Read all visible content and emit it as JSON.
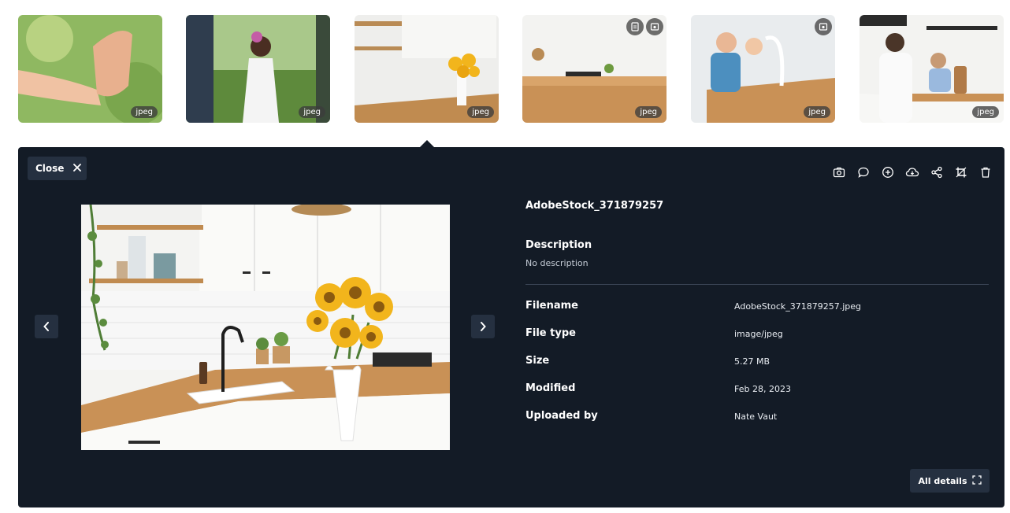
{
  "thumbnails": [
    {
      "badge": "jpeg",
      "has_overlay_icons": false
    },
    {
      "badge": "jpeg",
      "has_overlay_icons": false
    },
    {
      "badge": "jpeg",
      "has_overlay_icons": false
    },
    {
      "badge": "jpeg",
      "has_overlay_icons": true
    },
    {
      "badge": "jpeg",
      "has_overlay_icons": true
    },
    {
      "badge": "jpeg",
      "has_overlay_icons": false
    }
  ],
  "panel": {
    "close_label": "Close",
    "title": "AdobeStock_371879257",
    "description_heading": "Description",
    "description_value": "No description",
    "details": [
      {
        "label": "Filename",
        "value": "AdobeStock_371879257.jpeg"
      },
      {
        "label": "File type",
        "value": "image/jpeg"
      },
      {
        "label": "Size",
        "value": "5.27 MB"
      },
      {
        "label": "Modified",
        "value": "Feb 28, 2023"
      },
      {
        "label": "Uploaded by",
        "value": "Nate Vaut"
      }
    ],
    "all_details_label": "All details",
    "toolbar_icons": [
      "camera-icon",
      "comment-icon",
      "add-circle-icon",
      "cloud-download-icon",
      "share-icon",
      "crop-icon",
      "trash-icon"
    ]
  },
  "colors": {
    "panel_bg": "#131b26",
    "button_bg": "#253040",
    "accent_yellow": "#f2b51c"
  }
}
